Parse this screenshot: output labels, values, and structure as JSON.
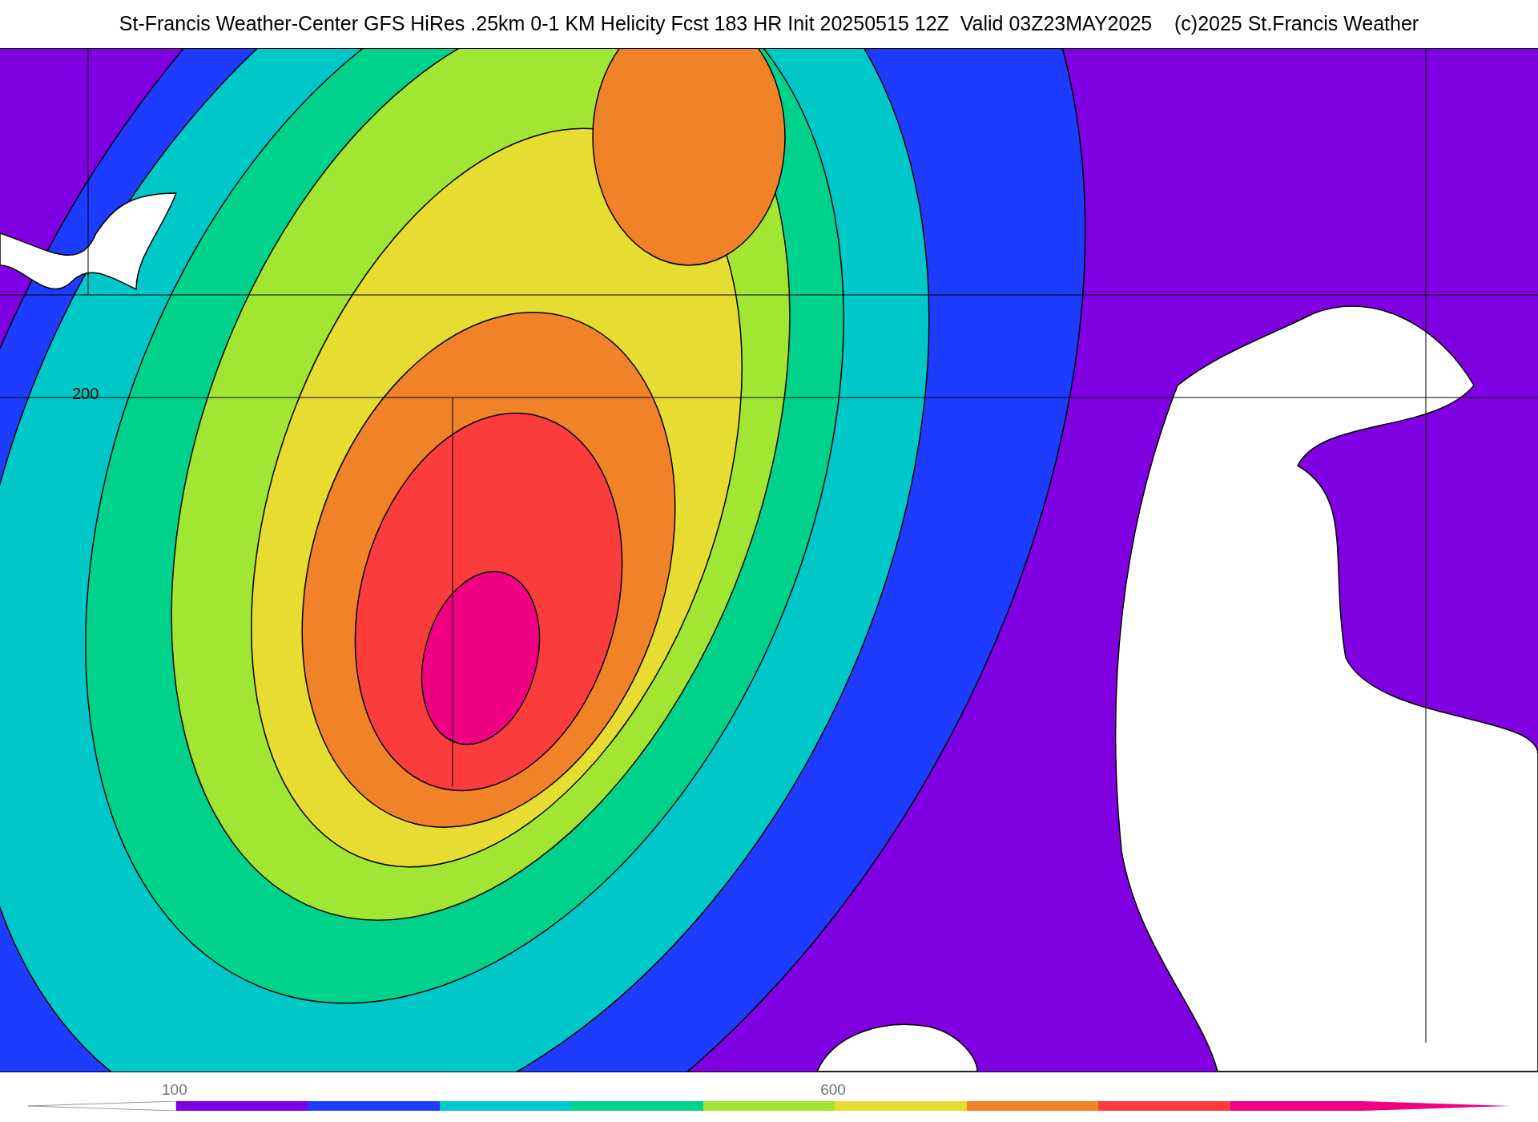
{
  "title": "St-Francis Weather-Center GFS HiRes .25km 0-1 KM Helicity Fcst 183 HR Init 20250515 12Z  Valid 03Z23MAY2025    (c)2025 St.Francis Weather",
  "map": {
    "contour_label": "200"
  },
  "colorbar": {
    "segments": [
      {
        "color": "#7f00e0",
        "label": "100"
      },
      {
        "color": "#1e3cff"
      },
      {
        "color": "#00c8c8"
      },
      {
        "color": "#00d28c"
      },
      {
        "color": "#a0e632"
      },
      {
        "color": "#e6dc32",
        "label": "600"
      },
      {
        "color": "#f08228"
      },
      {
        "color": "#fa3c3c"
      },
      {
        "color": "#f00082"
      }
    ]
  }
}
